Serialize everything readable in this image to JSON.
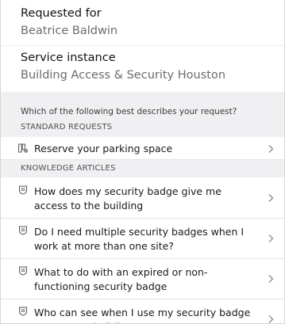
{
  "requested_for": {
    "label": "Requested for",
    "value": "Beatrice Baldwin"
  },
  "service_instance": {
    "label": "Service instance",
    "value": "Building Access & Security Houston"
  },
  "question": "Which of the following best describes your request?",
  "standard_requests": {
    "header": "STANDARD REQUESTS",
    "items": [
      {
        "label": "Reserve your parking space",
        "icon": "parking-icon"
      }
    ]
  },
  "knowledge_articles": {
    "header": "KNOWLEDGE ARTICLES",
    "items": [
      {
        "label": "How does my security badge give me access to the building",
        "icon": "knowledge-article-icon"
      },
      {
        "label": "Do I need multiple security badges when I work at more than one site?",
        "icon": "knowledge-article-icon"
      },
      {
        "label": "What to do with an expired or non-functioning security badge",
        "icon": "knowledge-article-icon"
      },
      {
        "label": "Who can see when I use my security badge to access a building",
        "icon": "knowledge-article-icon"
      }
    ]
  },
  "colors": {
    "section_bg": "#f0f0f3",
    "value_text": "#6b6b6b",
    "chevron": "#8a8a8a"
  }
}
